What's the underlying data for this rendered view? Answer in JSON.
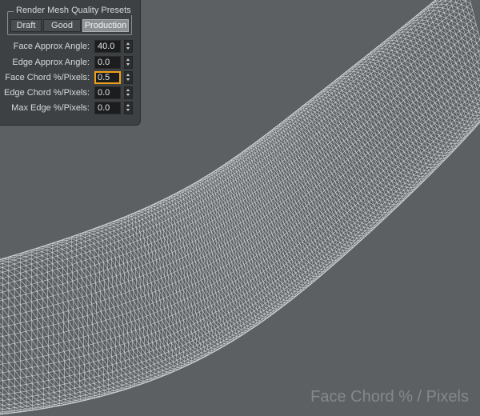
{
  "panel": {
    "presets_title": "Render Mesh Quality Presets",
    "presets": [
      {
        "label": "Draft",
        "active": false
      },
      {
        "label": "Good",
        "active": false
      },
      {
        "label": "Production",
        "active": true
      }
    ],
    "rows": [
      {
        "label": "Face Approx Angle:",
        "value": "40.0"
      },
      {
        "label": "Edge Approx Angle:",
        "value": "0.0"
      },
      {
        "label": "Face Chord %/Pixels:",
        "value": "0.5"
      },
      {
        "label": "Edge Chord %/Pixels:",
        "value": "0.0"
      },
      {
        "label": "Max Edge %/Pixels:",
        "value": "0.0"
      }
    ],
    "focused_row": 2,
    "focus_color": "#f0a018"
  },
  "viewport": {
    "background_color": "#5d6063",
    "wire_color": "#e2e4e6",
    "caption": "Face Chord % / Pixels"
  }
}
